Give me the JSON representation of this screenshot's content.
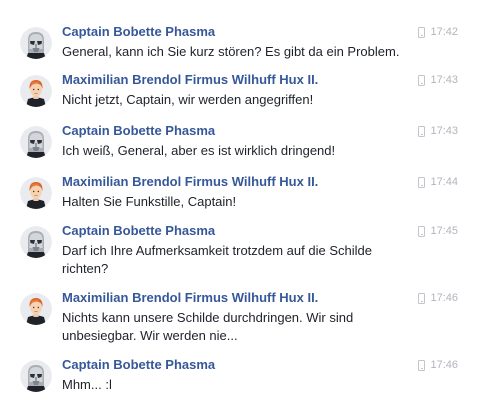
{
  "messages": [
    {
      "avatar": "stormtrooper-helmet-icon",
      "sender": "Captain Bobette Phasma",
      "text": "General, kann ich Sie kurz stören? Es gibt da ein Problem.",
      "device_icon": "mobile-phone-icon",
      "time": "17:42"
    },
    {
      "avatar": "red-haired-officer-icon",
      "sender": "Maximilian Brendol Firmus Wilhuff Hux II.",
      "text": "Nicht jetzt, Captain, wir werden angegriffen!",
      "device_icon": "mobile-phone-icon",
      "time": "17:43"
    },
    {
      "avatar": "stormtrooper-helmet-icon",
      "sender": "Captain Bobette Phasma",
      "text": "Ich weiß, General, aber es ist wirklich dringend!",
      "device_icon": "mobile-phone-icon",
      "time": "17:43"
    },
    {
      "avatar": "red-haired-officer-icon",
      "sender": "Maximilian Brendol Firmus Wilhuff Hux II.",
      "text": "Halten Sie Funkstille, Captain!",
      "device_icon": "mobile-phone-icon",
      "time": "17:44"
    },
    {
      "avatar": "stormtrooper-helmet-icon",
      "sender": "Captain Bobette Phasma",
      "text": "Darf ich Ihre Aufmerksamkeit trotzdem auf die Schilde richten?",
      "device_icon": "mobile-phone-icon",
      "time": "17:45"
    },
    {
      "avatar": "red-haired-officer-icon",
      "sender": "Maximilian Brendol Firmus Wilhuff Hux II.",
      "text": "Nichts kann unsere Schilde durchdringen. Wir sind unbesiegbar. Wir werden nie...",
      "device_icon": "mobile-phone-icon",
      "time": "17:46"
    },
    {
      "avatar": "stormtrooper-helmet-icon",
      "sender": "Captain Bobette Phasma",
      "text": "Mhm... :l",
      "device_icon": "mobile-phone-icon",
      "time": "17:46"
    }
  ],
  "colors": {
    "sender_name": "#365899",
    "message_text": "#1d2129",
    "timestamp": "#b0b5bd",
    "background": "#ffffff"
  }
}
